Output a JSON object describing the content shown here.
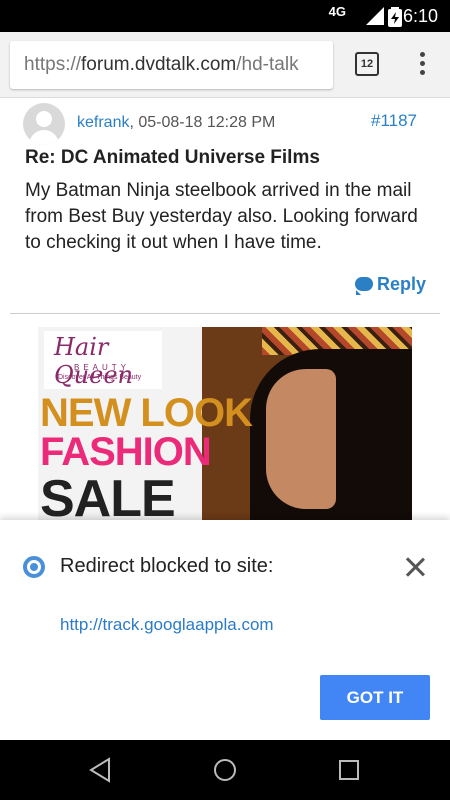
{
  "status_bar": {
    "network": "4G",
    "time": "6:10",
    "icons": [
      "signal-icon",
      "battery-icon"
    ]
  },
  "browser": {
    "url_scheme": "https://",
    "url_host": "forum.dvdtalk.com",
    "url_path": "/hd-talk",
    "tab_count": "12",
    "menu_icon": "more-vert-icon"
  },
  "post": {
    "author": "kefrank",
    "date": ", 05-08-18 12:28 PM",
    "number": "#1187",
    "title": "Re: DC Animated Universe Films",
    "body": "My Batman Ninja steelbook arrived in the mail from Best Buy yesterday also. Looking forward to checking it out when I have time.",
    "reply_label": "Reply"
  },
  "ad": {
    "logo_main": "Hair Queen",
    "logo_sub": "BEAUTY",
    "logo_tag": "Discover All Things Beauty",
    "line1": "NEW LOOK",
    "line2": "FASHION",
    "line3": "SALE"
  },
  "redirect_sheet": {
    "title": "Redirect blocked to site:",
    "link": "http://track.googlaappla.com",
    "button": "GOT IT"
  },
  "colors": {
    "link": "#2b80c5",
    "button": "#4285f4"
  }
}
